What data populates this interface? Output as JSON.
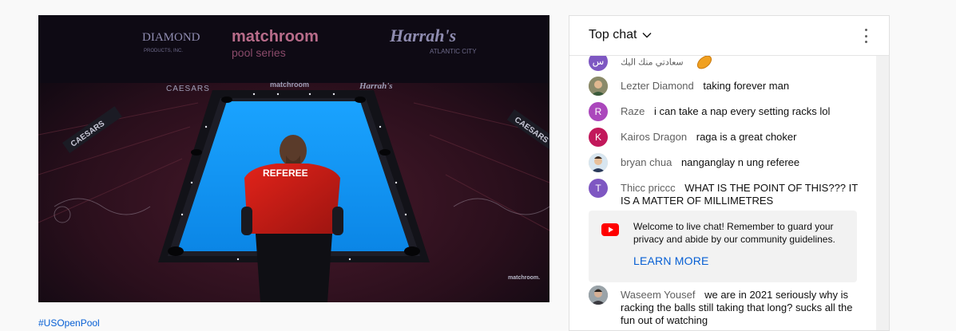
{
  "video": {
    "sponsor_top_1": "matchroom",
    "sponsor_top_2": "pool series",
    "sponsor_top_3": "Harrah's",
    "sponsor_top_3_sub": "ATLANTIC CITY",
    "sponsor_diamond": "DIAMOND",
    "sponsor_diamond_sub": "PRODUCTS, INC.",
    "rail_1": "CAESARS",
    "rail_2": "matchroom",
    "rail_3": "Harrah's",
    "side_left": "CAESARS",
    "side_right": "CAESARS",
    "referee_shirt": "REFEREE",
    "watermark": "matchroom."
  },
  "hashtag": "#USOpenPool",
  "chat": {
    "title": "Top chat",
    "messages": [
      {
        "author": "",
        "text": "سعادتي منك اليك",
        "avatar_letter": "س",
        "avatar_color": "#7e57c2"
      },
      {
        "author": "Lezter Diamond",
        "text": "taking forever man",
        "avatar_letter": "",
        "avatar_color": "#c7b98a"
      },
      {
        "author": "Raze",
        "text": "i can take a nap every setting racks lol",
        "avatar_letter": "R",
        "avatar_color": "#ab47bc"
      },
      {
        "author": "Kairos Dragon",
        "text": "raga is a great choker",
        "avatar_letter": "K",
        "avatar_color": "#c2185b"
      },
      {
        "author": "bryan chua",
        "text": "nanganglay n ung referee",
        "avatar_letter": "",
        "avatar_color": "#e9d3b0"
      },
      {
        "author": "Thicc priccc",
        "text": "WHAT IS THE POINT OF THIS??? IT IS A MATTER OF MILLIMETRES",
        "avatar_letter": "T",
        "avatar_color": "#7e57c2"
      },
      {
        "author": "Waseem Yousef",
        "text": "we are in 2021 seriously why is racking the balls still taking that long? sucks all the fun out of watching",
        "avatar_letter": "",
        "avatar_color": "#5d6d7e"
      }
    ],
    "welcome": {
      "text": "Welcome to live chat! Remember to guard your privacy and abide by our community guidelines.",
      "link": "LEARN MORE"
    },
    "colors": {
      "link": "#065fd4",
      "youtube_red": "#ff0000"
    }
  }
}
